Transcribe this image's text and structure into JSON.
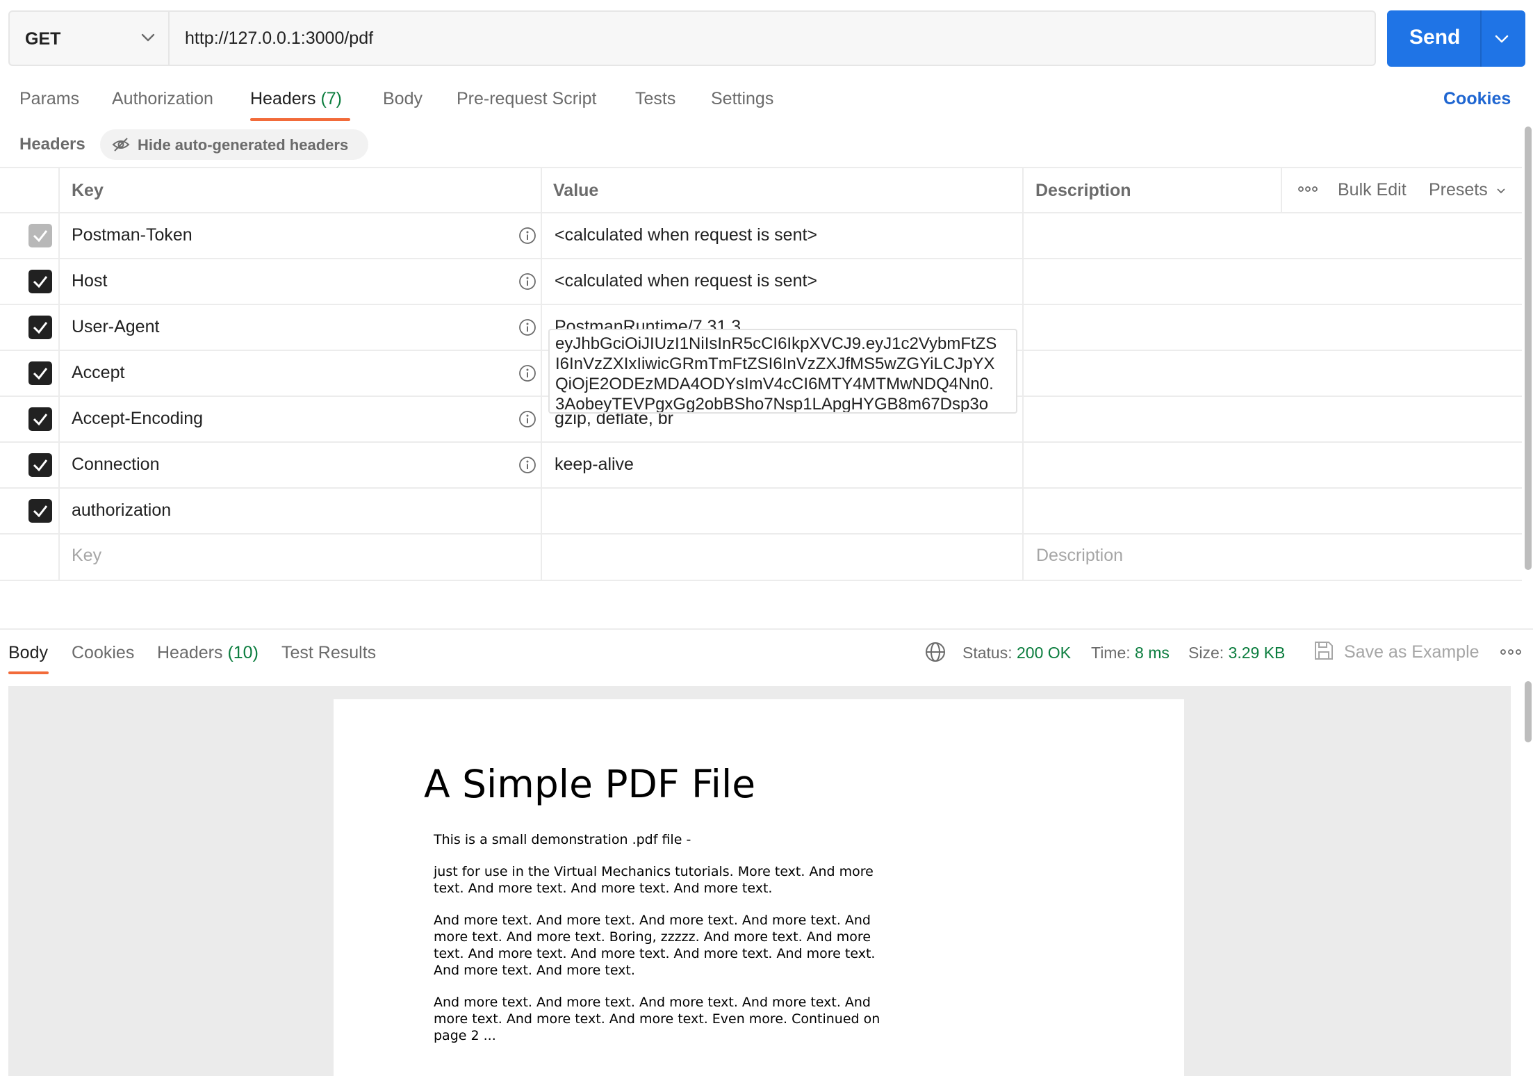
{
  "request": {
    "method": "GET",
    "url": "http://127.0.0.1:3000/pdf",
    "send_label": "Send"
  },
  "tabs": [
    {
      "label": "Params"
    },
    {
      "label": "Authorization"
    },
    {
      "label": "Headers",
      "count": "(7)"
    },
    {
      "label": "Body"
    },
    {
      "label": "Pre-request Script"
    },
    {
      "label": "Tests"
    },
    {
      "label": "Settings"
    }
  ],
  "active_tab": "Headers",
  "cookies_label": "Cookies",
  "headers_section": {
    "title": "Headers",
    "toggle_label": "Hide auto-generated headers"
  },
  "table": {
    "columns": {
      "key": "Key",
      "value": "Value",
      "description": "Description"
    },
    "bulk_edit": "Bulk Edit",
    "presets": "Presets",
    "rows": [
      {
        "key": "Postman-Token",
        "value": "<calculated when request is sent>",
        "checked": true,
        "locked": true
      },
      {
        "key": "Host",
        "value": "<calculated when request is sent>",
        "checked": true
      },
      {
        "key": "User-Agent",
        "value": "PostmanRuntime/7.31.3",
        "checked": true
      },
      {
        "key": "Accept",
        "value": "*/*",
        "checked": true
      },
      {
        "key": "Accept-Encoding",
        "value": "gzip, deflate, br",
        "checked": true
      },
      {
        "key": "Connection",
        "value": "keep-alive",
        "checked": true
      },
      {
        "key": "authorization",
        "checked": true,
        "value_lines": [
          "eyJhbGciOiJIUzI1NiIsInR5cCI6IkpXVCJ9.eyJ1c2VybmFtZS",
          "I6InVzZXIxIiwicGRmTmFtZSI6InVzZXJfMS5wZGYiLCJpYX",
          "QiOjE2ODEzMDA4ODYsImV4cCI6MTY4MTMwNDQ4Nn0.",
          "3AobeyTEVPgxGg2obBSho7Nsp1LApgHYGB8m67Dsp3o"
        ]
      }
    ],
    "new_row": {
      "key_placeholder": "Key",
      "description_placeholder": "Description"
    }
  },
  "response": {
    "tabs": [
      {
        "label": "Body"
      },
      {
        "label": "Cookies"
      },
      {
        "label": "Headers",
        "count": "(10)"
      },
      {
        "label": "Test Results"
      }
    ],
    "active_tab": "Body",
    "status_label": "Status:",
    "status_value": "200 OK",
    "time_label": "Time:",
    "time_value": "8 ms",
    "size_label": "Size:",
    "size_value": "3.29 KB",
    "save_example": "Save as Example"
  },
  "pdf": {
    "title": "A Simple PDF File",
    "paragraphs": [
      "This is a small demonstration .pdf file -",
      "just for use in the Virtual Mechanics tutorials. More text. And more text. And more text. And more text. And more text.",
      "And more text. And more text. And more text. And more text. And more text. And more text. Boring, zzzzz. And more text. And more text. And more text. And more text. And more text. And more text. And more text. And more text.",
      "And more text. And more text. And more text. And more text. And more text. And more text. And more text. Even more. Continued on page 2 ..."
    ]
  },
  "colors": {
    "accent": "#f26b3a",
    "send": "#1f74e6",
    "link": "#1f66d1",
    "success": "#0b7d3e"
  },
  "icons": [
    "chevron-down-icon",
    "eye-off-icon",
    "info-icon",
    "checkbox-icon",
    "more-icon",
    "globe-icon",
    "save-icon"
  ]
}
